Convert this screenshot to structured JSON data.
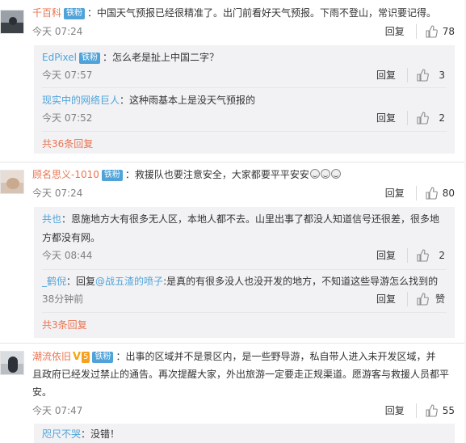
{
  "thread": {
    "reply_label": "回复",
    "accent_color": "#eb7350",
    "badge_color": "#4fa3d9",
    "comments": [
      {
        "user": "千百科",
        "badge": "铁粉",
        "colon": "：",
        "text": "中国天气预报已经很精准了。出门前看好天气预报。下雨不登山，常识要记得。",
        "time": "今天 07:24",
        "likes": "78",
        "replies": [
          {
            "user": "EdPixel",
            "badge": "铁粉",
            "colon": "：",
            "text": "怎么老是扯上中国二字？",
            "time": "今天 07:57",
            "likes": "3"
          },
          {
            "user": "现实中的网络巨人",
            "colon": "：",
            "text": "这种雨基本上是没天气预报的",
            "time": "今天 07:52",
            "likes": "2"
          }
        ],
        "more": "共36条回复"
      },
      {
        "user": "顾名思义-1010",
        "badge": "铁粉",
        "colon": "：",
        "text": "救援队也要注意安全，大家都要平平安安",
        "time": "今天 07:24",
        "likes": "80",
        "replies": [
          {
            "user": "共也",
            "colon": "：",
            "text_line1": "恩施地方大有很多无人区，本地人都不去。山里出事了都没人知道信号还很差，很多地",
            "text_line2": "方都没有网。",
            "time": "今天 08:44",
            "likes": "2"
          },
          {
            "user": "_鹤倪",
            "colon": "：",
            "prefix": "回复",
            "mention": "@战五渣的喷子",
            "text": ":是真的有很多没人也没开发的地方，不知道这些导游怎么找到的",
            "time": "38分钟前",
            "likes": "赞"
          }
        ],
        "more": "共3条回复"
      },
      {
        "user": "潮流依旧",
        "v_mark": "V",
        "level": "5",
        "badge": "铁粉",
        "colon": "：",
        "text_line1": "出事的区域并不是景区内，是一些野导游，私自带人进入未开发区域，并",
        "text_line2": "且政府已经发过禁止的通告。再次提醒大家，外出旅游一定要走正规渠道。愿游客与救援人员都平",
        "text_line3": "安。",
        "time": "今天 07:47",
        "likes": "55",
        "replies": [
          {
            "user": "咫尺不哭",
            "colon": "：",
            "text": "没错！"
          }
        ]
      }
    ]
  }
}
